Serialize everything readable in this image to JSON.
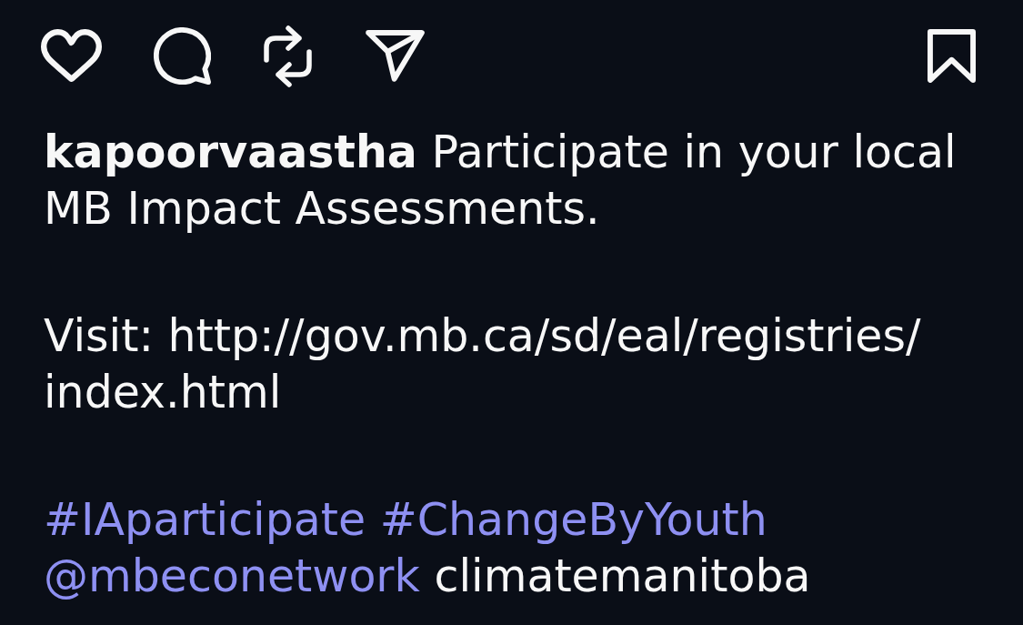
{
  "actions": {
    "liked": false,
    "saved": false
  },
  "caption": {
    "username": "kapoorvaastha",
    "text": "Participate in your local MB Impact Assessments.",
    "visit": "Visit: http://gov.mb.ca/sd/eal/registries/index.html",
    "tags": [
      {
        "kind": "hashtag",
        "text": "#IAparticipate"
      },
      {
        "kind": "hashtag",
        "text": "#ChangeByYouth"
      },
      {
        "kind": "mention",
        "text": "@mbeconetwork"
      },
      {
        "kind": "plain",
        "text": "climatemanitoba"
      }
    ]
  }
}
